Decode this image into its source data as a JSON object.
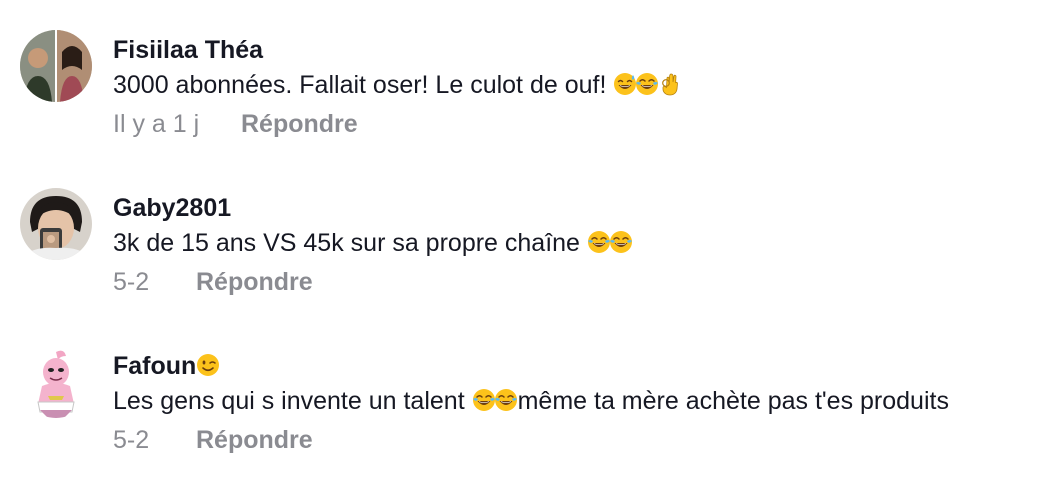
{
  "comments": [
    {
      "username": "Fisiilaa Théa",
      "text": "3000 abonnées. Fallait oser! Le culot de ouf!",
      "emojis": [
        "sweat-smile-emoji",
        "joy-emoji",
        "ok-hand-emoji"
      ],
      "time": "Il y a 1 j",
      "reply_label": "Répondre"
    },
    {
      "username": "Gaby2801",
      "text": "3k de 15 ans VS 45k sur sa propre chaîne",
      "emojis": [
        "joy-emoji",
        "joy-emoji"
      ],
      "time": "5-2",
      "reply_label": "Répondre"
    },
    {
      "username": "Fafoun",
      "username_emoji": "wink-emoji",
      "text_before": "Les gens qui s invente un talent",
      "emojis": [
        "joy-emoji",
        "joy-emoji"
      ],
      "text_after": "même ta mère achète pas t'es produits",
      "time": "5-2",
      "reply_label": "Répondre"
    }
  ],
  "colors": {
    "username": "#161823",
    "text": "#161823",
    "meta": "#8a8b91",
    "emoji_face": "#fcc21b"
  }
}
